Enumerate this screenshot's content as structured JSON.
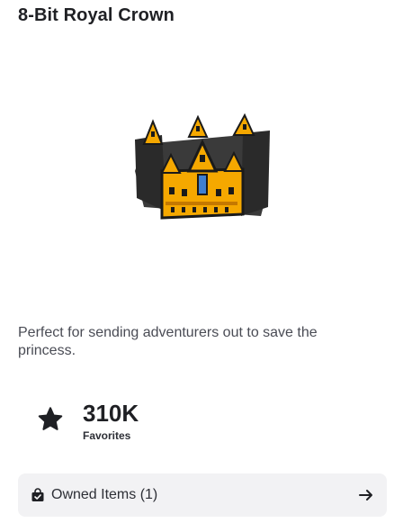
{
  "item": {
    "title": "8-Bit Royal Crown",
    "image_icon": "pixel-crown-image",
    "description": "Perfect for sending adventurers out to save the princess."
  },
  "favorites": {
    "icon": "star-icon",
    "count": "310K",
    "label": "Favorites"
  },
  "owned": {
    "icon": "shopping-bag-check-icon",
    "label": "Owned Items (1)",
    "arrow_icon": "arrow-right-icon"
  },
  "colors": {
    "text_primary": "#1f2024",
    "text_secondary": "#4a4c55",
    "bar_background": "#f2f2f4",
    "crown_gold": "#f5a800",
    "crown_dark": "#2a2a2a",
    "crown_gem": "#3f7fd0"
  }
}
